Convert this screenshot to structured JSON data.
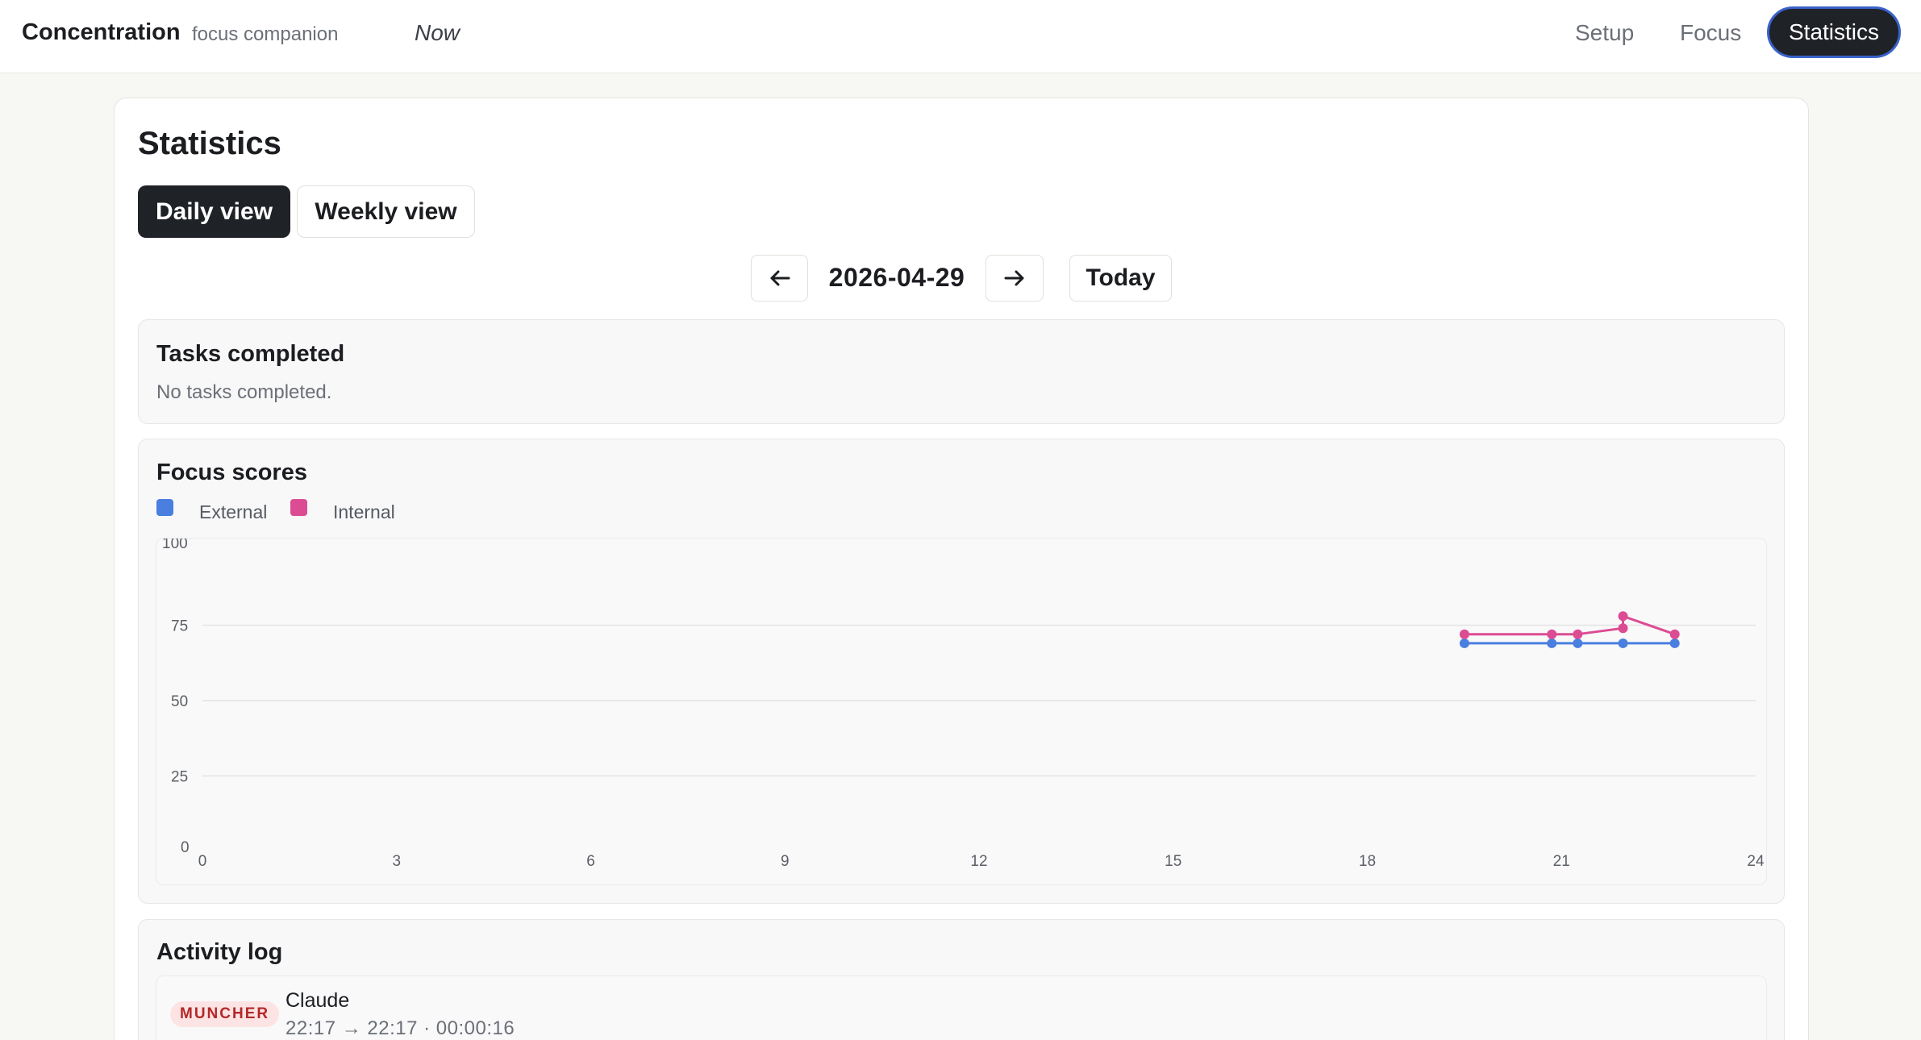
{
  "app": {
    "name": "Concentration",
    "tagline": "focus companion",
    "now_label": "Now"
  },
  "nav": {
    "setup": "Setup",
    "focus": "Focus",
    "statistics": "Statistics",
    "active": "statistics"
  },
  "page": {
    "title": "Statistics",
    "views": {
      "daily": "Daily view",
      "weekly": "Weekly view",
      "selected": "daily"
    },
    "date_nav": {
      "prev_icon": "arrow-left-icon",
      "date": "2026-04-29",
      "next_icon": "arrow-right-icon",
      "today": "Today"
    }
  },
  "tasks": {
    "title": "Tasks completed",
    "empty_text": "No tasks completed."
  },
  "focus": {
    "title": "Focus scores"
  },
  "activity": {
    "title": "Activity log",
    "entries": [
      {
        "badge": "MUNCHER",
        "name": "Claude",
        "time": "22:17 → 22:17 · 00:00:16"
      }
    ]
  },
  "colors": {
    "external": "#4a7fe0",
    "internal": "#dc4c93",
    "badge_bg": "#fde4e4",
    "badge_text": "#b42828",
    "nav_active_bg": "#1f2227"
  },
  "chart_data": {
    "type": "line",
    "title": "Focus scores",
    "xlabel": "",
    "ylabel": "",
    "xlim": [
      0,
      24
    ],
    "ylim": [
      0,
      100
    ],
    "x_ticks": [
      0,
      3,
      6,
      9,
      12,
      15,
      18,
      21,
      24
    ],
    "y_ticks": [
      0,
      25,
      50,
      75,
      100
    ],
    "grid": "horizontal",
    "legend": "top-left",
    "series": [
      {
        "name": "External",
        "color": "#4a7fe0",
        "x": [
          19.5,
          20.85,
          21.25,
          21.95,
          22.75
        ],
        "y": [
          69,
          69,
          69,
          69,
          69
        ]
      },
      {
        "name": "Internal",
        "color": "#dc4c93",
        "x": [
          19.5,
          20.85,
          21.25,
          21.95,
          21.95,
          22.75
        ],
        "y": [
          72,
          72,
          72,
          74,
          78,
          72
        ]
      }
    ]
  }
}
